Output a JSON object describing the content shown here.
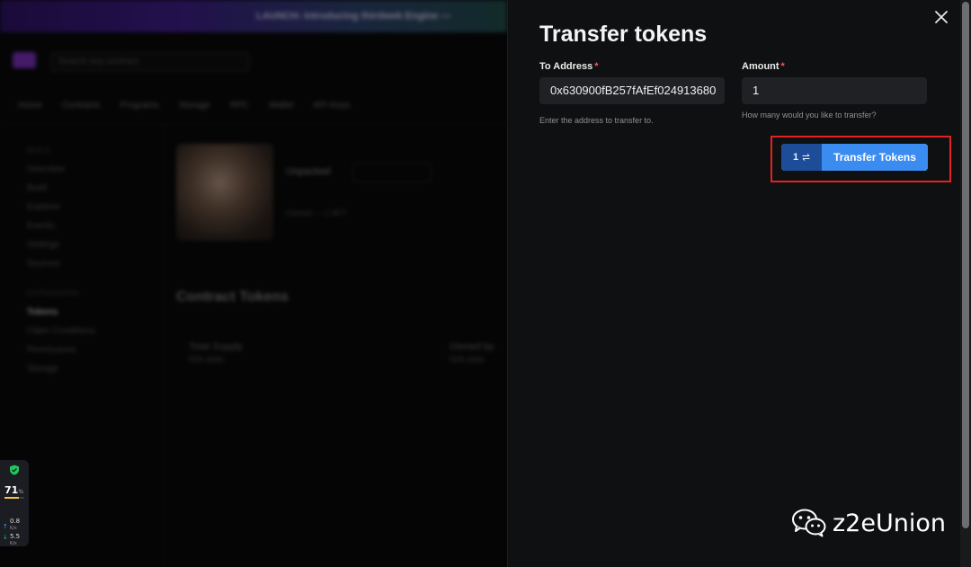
{
  "background": {
    "announcement": "LAUNCH: Introducing thirdweb Engine —",
    "search_placeholder": "Search any contract",
    "nav_items": [
      "Home",
      "Contracts",
      "Programs",
      "Storage",
      "RPC",
      "Wallet",
      "API Keys"
    ],
    "sidebar": {
      "section_1": "Build",
      "items_1": [
        "Overview",
        "Build",
        "Explorer",
        "Events",
        "Settings",
        "Sources"
      ],
      "section_2": "Extensions",
      "items_2": [
        "Tokens",
        "Claim Conditions",
        "Permissions",
        "Storage"
      ],
      "active_item": "Tokens"
    },
    "nft_name": "Unpacked",
    "nft_chip": "View Token",
    "nft_sub": "Owned — 1 NFT",
    "contract_title": "Contract Tokens",
    "stats": [
      {
        "label": "Total Supply",
        "value": "N/A data"
      },
      {
        "label": "Owned by",
        "value": "N/A data"
      }
    ]
  },
  "status_widget": {
    "percent": "71",
    "percent_unit": "%",
    "percent_fill": 0.71,
    "upload": "0.8",
    "upload_unit": "K/s",
    "download": "5.5",
    "download_unit": "K/s",
    "colors": {
      "shield": "#22c55e",
      "bar": "#f5c542"
    }
  },
  "modal": {
    "title": "Transfer tokens",
    "close_icon": "close-icon",
    "to_address": {
      "label": "To Address",
      "required_marker": "*",
      "value": "0x630900fB257fAfEf024913680",
      "helper": "Enter the address to transfer to."
    },
    "amount": {
      "label": "Amount",
      "required_marker": "*",
      "value": "1",
      "helper": "How many would you like to transfer?"
    },
    "submit": {
      "count": "1",
      "count_icon": "transfer-arrows-icon",
      "label": "Transfer Tokens"
    },
    "colors": {
      "background": "#0f1011",
      "input_bg": "#1f2124",
      "button_primary": "#3b8cf1",
      "button_badge": "#1d4d98",
      "required": "#f05a5a",
      "highlight": "#e42222"
    }
  },
  "watermark": {
    "text": "z2eUnion",
    "icon": "wechat-icon"
  }
}
